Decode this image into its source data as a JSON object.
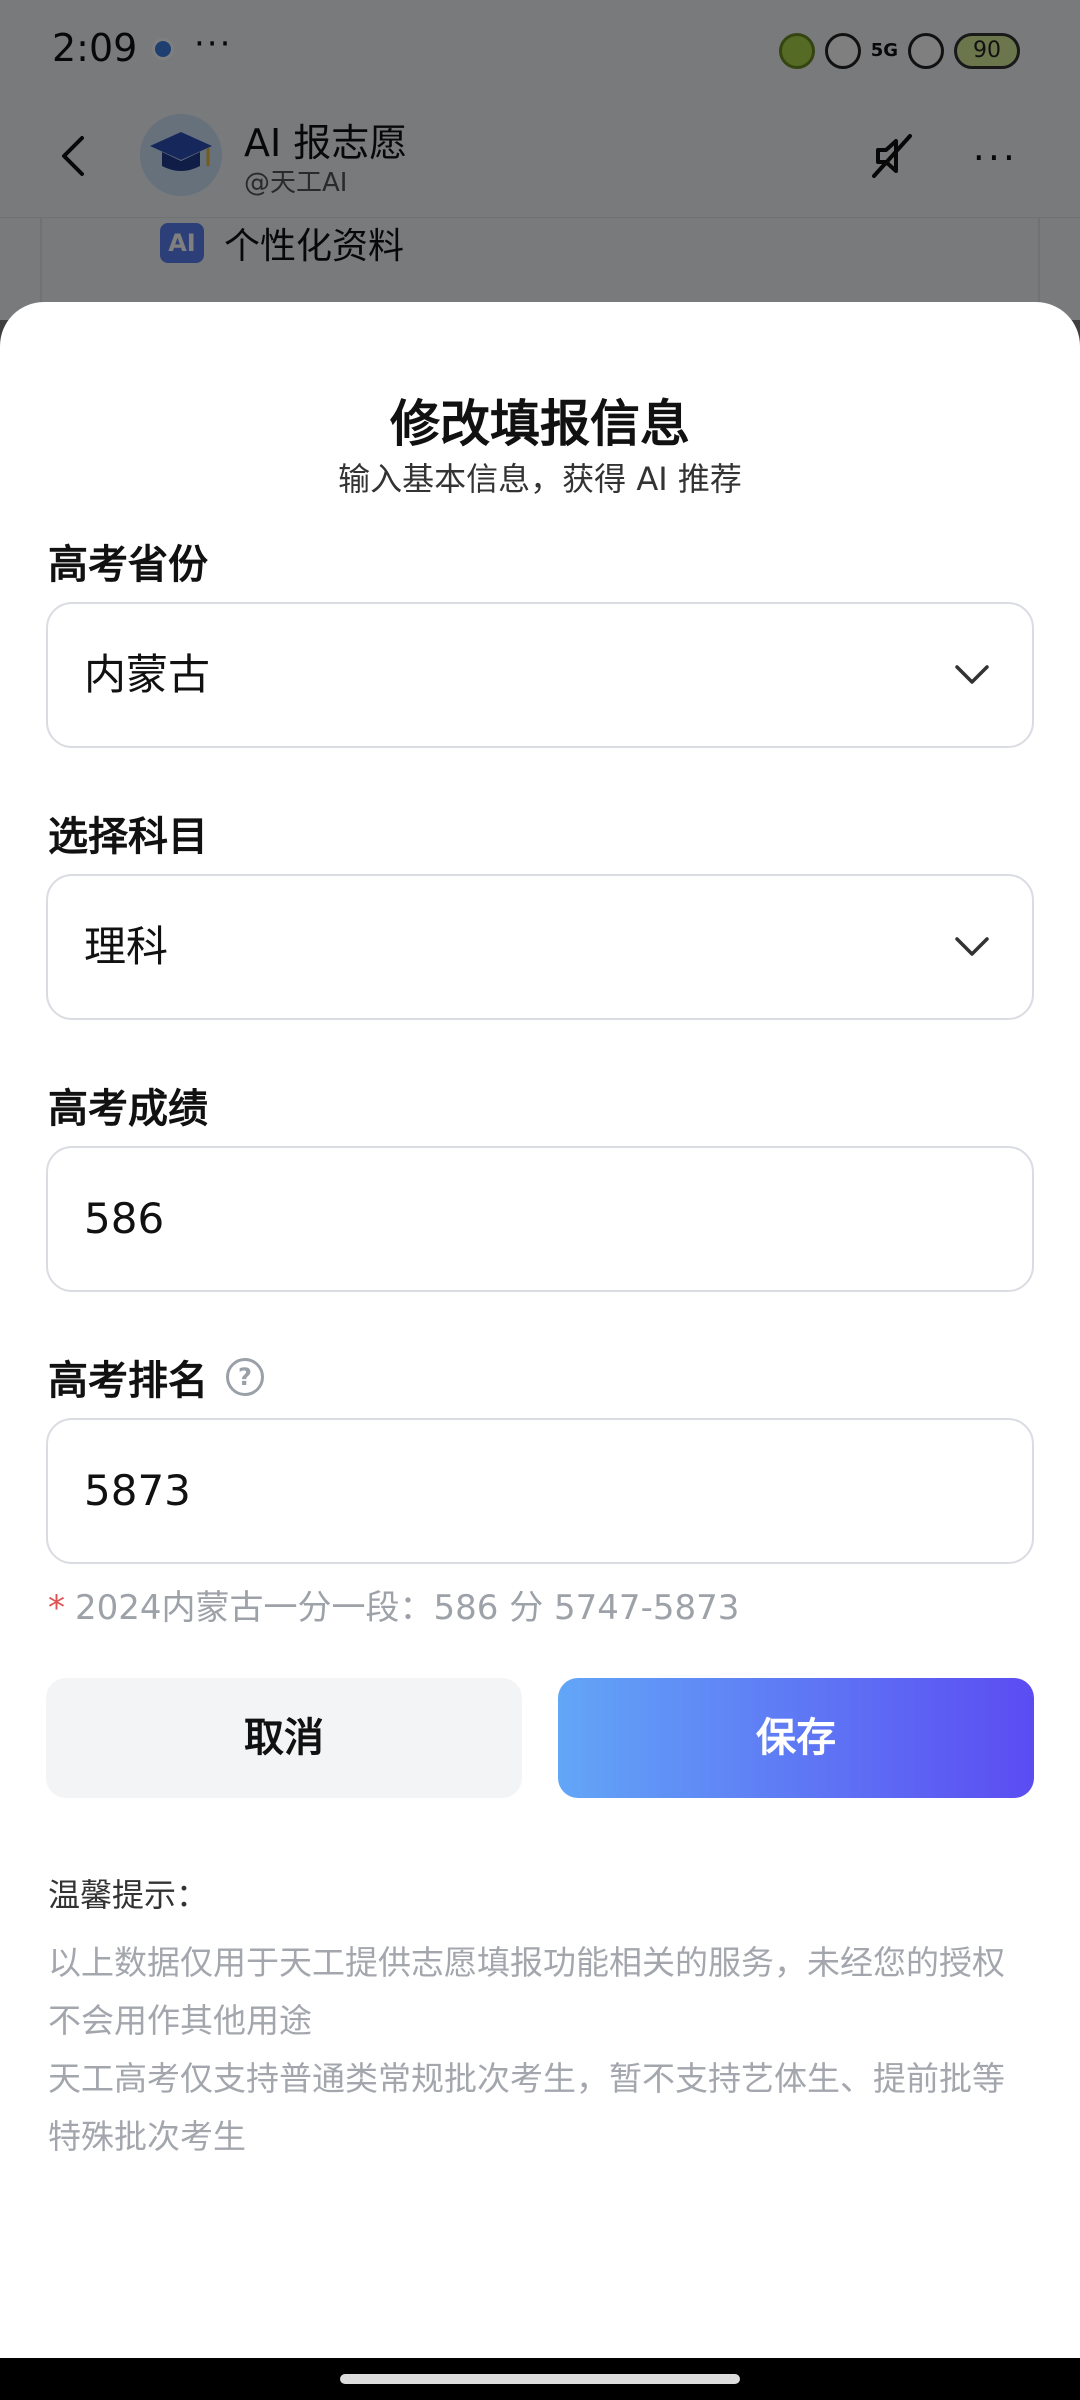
{
  "status_bar": {
    "time": "2:09",
    "more": "···",
    "network": "5G",
    "battery": "90"
  },
  "chat_header": {
    "bot_name": "AI 报志愿",
    "bot_handle": "@天工AI",
    "profile_label": "个性化资料",
    "ai_badge": "AI"
  },
  "sheet": {
    "title": "修改填报信息",
    "subtitle": "输入基本信息，获得 AI 推荐",
    "province": {
      "label": "高考省份",
      "value": "内蒙古"
    },
    "subject": {
      "label": "选择科目",
      "value": "理科"
    },
    "score": {
      "label": "高考成绩",
      "value": "586"
    },
    "rank": {
      "label": "高考排名",
      "value": "5873",
      "help": "?"
    },
    "rank_note_star": "*",
    "rank_note": "2024内蒙古一分一段：586 分 5747-5873",
    "cancel_label": "取消",
    "save_label": "保存",
    "tips": {
      "title": "温馨提示：",
      "lines": [
        "以上数据仅用于天工提供志愿填报功能相关的服务，未经您的授权不会用作其他用途",
        "天工高考仅支持普通类常规批次考生，暂不支持艺体生、提前批等特殊批次考生"
      ]
    }
  },
  "colors": {
    "accent_start": "#62a6f7",
    "accent_end": "#5b4cf2",
    "required_star": "#e05252"
  }
}
